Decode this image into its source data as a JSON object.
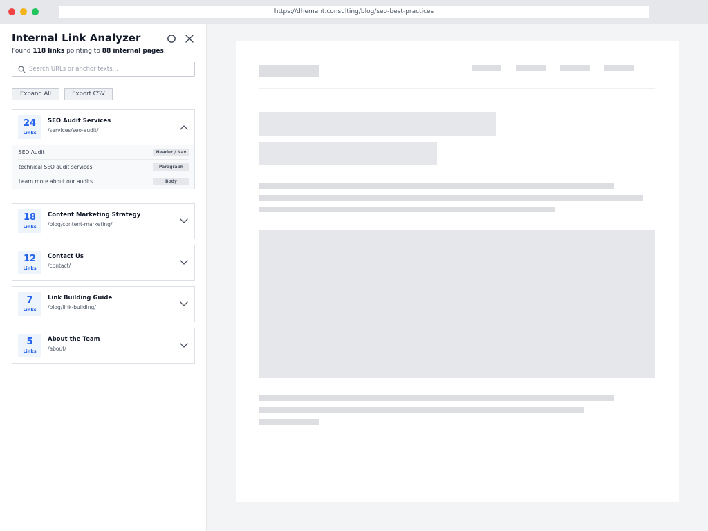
{
  "browser": {
    "url": "https://dhemant.consulting/blog/seo-best-practices"
  },
  "panel": {
    "title": "Internal Link Analyzer",
    "summary": {
      "prefix": "Found ",
      "links": "118 links",
      "middle": " pointing to ",
      "pages": "88 internal pages",
      "suffix": "."
    },
    "search": {
      "placeholder": "Search URLs or anchor texts..."
    },
    "actions": {
      "expand_all": "Expand All",
      "export_csv": "Export CSV"
    },
    "count_label": "Links",
    "pages": [
      {
        "count": "24",
        "title": "SEO Audit Services",
        "path": "/services/seo-audit/",
        "expanded": true,
        "links": [
          {
            "anchor": "SEO Audit",
            "placement": "Header / Nav"
          },
          {
            "anchor": "technical SEO audit services",
            "placement": "Paragraph"
          },
          {
            "anchor": "Learn more about our audits",
            "placement": "Body"
          }
        ]
      },
      {
        "count": "18",
        "title": "Content Marketing Strategy",
        "path": "/blog/content-marketing/",
        "expanded": false
      },
      {
        "count": "12",
        "title": "Contact Us",
        "path": "/contact/",
        "expanded": false
      },
      {
        "count": "7",
        "title": "Link Building Guide",
        "path": "/blog/link-building/",
        "expanded": false
      },
      {
        "count": "5",
        "title": "About the Team",
        "path": "/about/",
        "expanded": false
      }
    ]
  },
  "colors": {
    "accent": "#2563eb",
    "count_bg": "#eef4fc",
    "close_red": "#ef4444",
    "minimize_yellow": "#f5b31a",
    "zoom_green": "#22c55e"
  }
}
